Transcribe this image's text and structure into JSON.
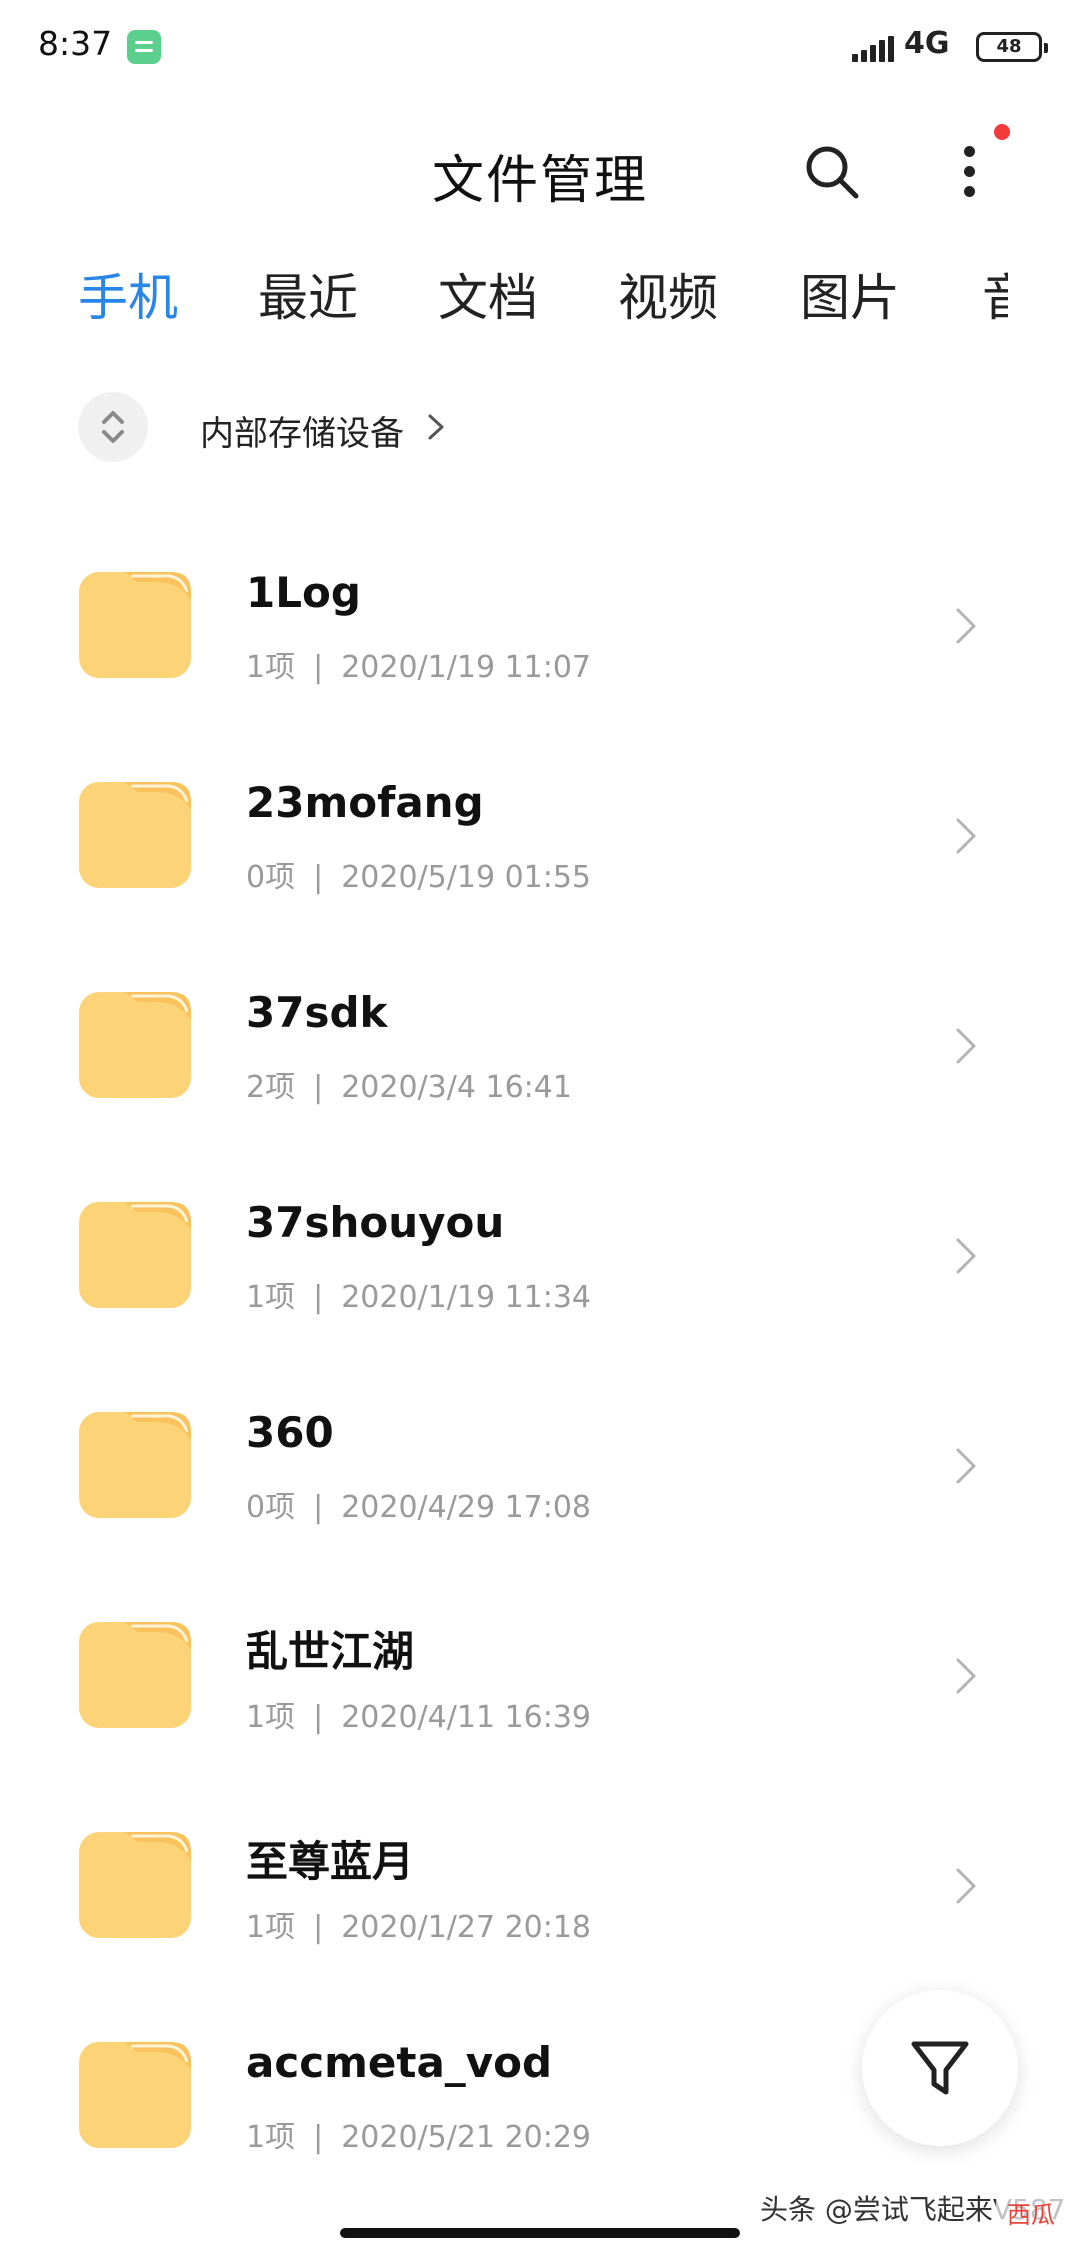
{
  "status_bar": {
    "time": "8:37",
    "network": "4G",
    "battery": "48",
    "app_icon": "notes-app-icon"
  },
  "title_bar": {
    "title": "文件管理",
    "search_icon": "search-icon",
    "more_icon": "more-vertical-icon",
    "notification_dot_color": "#f23b3b"
  },
  "tabs": [
    {
      "label": "手机",
      "active": true
    },
    {
      "label": "最近",
      "active": false
    },
    {
      "label": "文档",
      "active": false
    },
    {
      "label": "视频",
      "active": false
    },
    {
      "label": "图片",
      "active": false
    },
    {
      "label": "音",
      "active": false
    }
  ],
  "accent_color": "#2a86e6",
  "breadcrumb": {
    "label": "内部存储设备",
    "switch_icon": "expand-collapse-icon",
    "chevron_icon": "chevron-right-icon"
  },
  "files": [
    {
      "name": "1Log",
      "count": "1项",
      "date": "2020/1/19 11:07"
    },
    {
      "name": "23mofang",
      "count": "0项",
      "date": "2020/5/19 01:55"
    },
    {
      "name": "37sdk",
      "count": "2项",
      "date": "2020/3/4 16:41"
    },
    {
      "name": "37shouyou",
      "count": "1项",
      "date": "2020/1/19 11:34"
    },
    {
      "name": "360",
      "count": "0项",
      "date": "2020/4/29 17:08"
    },
    {
      "name": "乱世江湖",
      "count": "1项",
      "date": "2020/4/11 16:39"
    },
    {
      "name": "至尊蓝月",
      "count": "1项",
      "date": "2020/1/27 20:18"
    },
    {
      "name": "accmeta_vod",
      "count": "1项",
      "date": "2020/5/21 20:29"
    }
  ],
  "meta_separator": "|",
  "folder_color": "#fcd477",
  "filter_icon": "filter-icon",
  "watermark": {
    "text": "头条 @尝试飞起来V587",
    "logo": "西瓜"
  }
}
